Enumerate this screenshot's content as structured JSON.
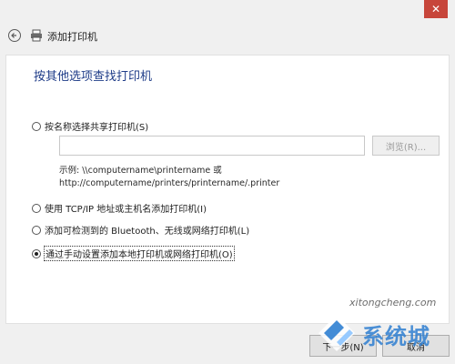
{
  "window": {
    "close_symbol": "✕"
  },
  "header": {
    "title": "添加打印机",
    "back_icon": "back-arrow-icon",
    "printer_icon": "printer-icon"
  },
  "main": {
    "heading": "按其他选项查找打印机",
    "options": [
      {
        "label": "按名称选择共享打印机(S)",
        "checked": false
      },
      {
        "label": "使用 TCP/IP 地址或主机名添加打印机(I)",
        "checked": false
      },
      {
        "label": "添加可检测到的 Bluetooth、无线或网络打印机(L)",
        "checked": false
      },
      {
        "label": "通过手动设置添加本地打印机或网络打印机(O)",
        "checked": true
      }
    ],
    "share_input": {
      "value": "",
      "placeholder": ""
    },
    "browse_label": "浏览(R)...",
    "example_line1": "示例: \\\\computername\\printername 或",
    "example_line2": "http://computername/printers/printername/.printer"
  },
  "footer": {
    "next_label": "下一步(N)",
    "cancel_label": "取消"
  },
  "watermark": {
    "url": "xitongcheng.com",
    "text": "系统城"
  },
  "colors": {
    "heading": "#1f3c88",
    "close": "#c7463b",
    "watermark_blue": "#2f7fd1"
  }
}
